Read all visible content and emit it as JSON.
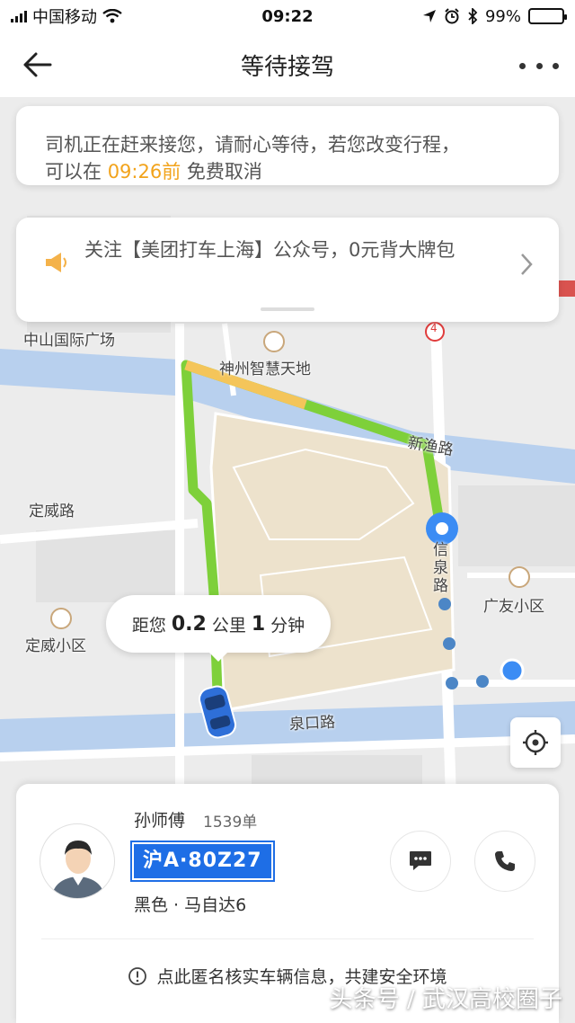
{
  "status_bar": {
    "carrier": "中国移动",
    "time": "09:22",
    "battery": "99%"
  },
  "nav": {
    "title": "等待接驾"
  },
  "notice": {
    "line1": "司机正在赶来接您，请耐心等待，若您改变行程，",
    "prefix": "可以在 ",
    "deadline": "09:26前",
    "suffix": " 免费取消"
  },
  "promo": {
    "text": "关注【美团打车上海】公众号，0元背大牌包"
  },
  "map": {
    "labels": {
      "zhongshan_plaza": "中山国际广场",
      "shenzhou": "神州智慧天地",
      "xinyu_road": "新渔路",
      "dingwei_road": "定威路",
      "xinquan_road": "信泉路",
      "guangyou": "广友小区",
      "dingwei_community": "定威小区",
      "quankou_road": "泉口路",
      "route_badge": "4"
    },
    "distance": {
      "prefix": "距您",
      "km": "0.2",
      "km_unit": "公里",
      "min": "1",
      "min_unit": "分钟"
    }
  },
  "driver": {
    "name": "孙师傅",
    "orders": "1539单",
    "plate": "沪A·80Z27",
    "car": "黑色 · 马自达6"
  },
  "safety_notice": "点此匿名核实车辆信息，共建安全环境",
  "watermark": "头条号 / 武汉高校圈子",
  "colors": {
    "accent_orange": "#f2a31b",
    "route_green": "#7ed03a",
    "plate_blue": "#1e6ee6"
  }
}
